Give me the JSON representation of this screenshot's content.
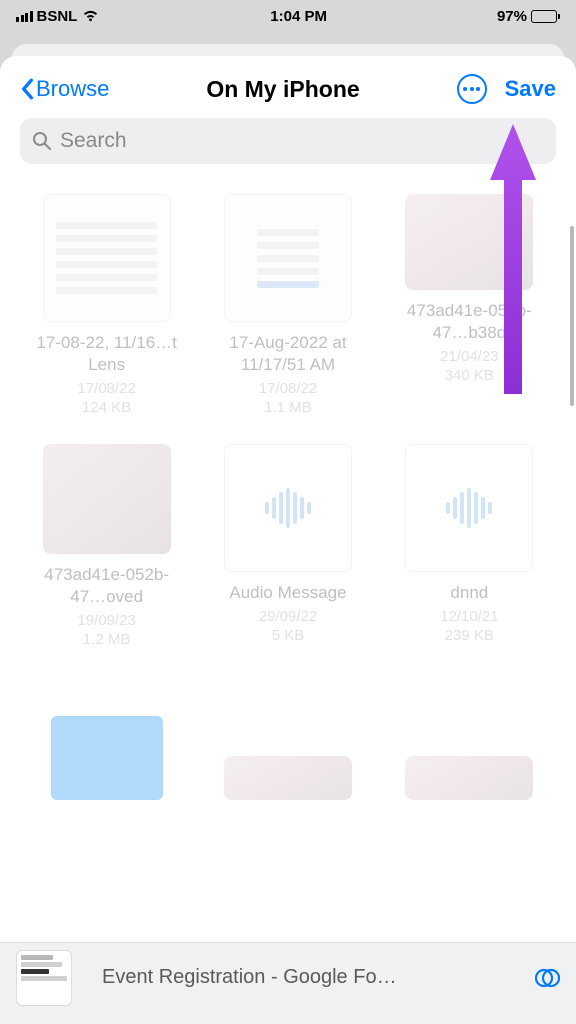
{
  "statusBar": {
    "carrier": "BSNL",
    "time": "1:04 PM",
    "batteryPercent": "97%",
    "batteryFill": 97
  },
  "nav": {
    "back": "Browse",
    "title": "On My iPhone",
    "save": "Save"
  },
  "search": {
    "placeholder": "Search"
  },
  "files": [
    {
      "name": "17-08-22, 11/16…t Lens",
      "date": "17/08/22",
      "size": "124 KB",
      "type": "screenshot"
    },
    {
      "name": "17-Aug-2022 at 11/17/51 AM",
      "date": "17/08/22",
      "size": "1.1 MB",
      "type": "screenshot"
    },
    {
      "name": "473ad41e-052b-47…b38d",
      "date": "21/04/23",
      "size": "340 KB",
      "type": "photo"
    },
    {
      "name": "473ad41e-052b-47…oved",
      "date": "19/09/23",
      "size": "1.2 MB",
      "type": "photo2"
    },
    {
      "name": "Audio Message",
      "date": "29/09/22",
      "size": "5 KB",
      "type": "audio"
    },
    {
      "name": "dnnd",
      "date": "12/10/21",
      "size": "239 KB",
      "type": "audio"
    }
  ],
  "browser": {
    "address": "Event Registration - Google Fo…"
  },
  "colors": {
    "accent": "#007aff",
    "annotation": "#9a3be0"
  }
}
